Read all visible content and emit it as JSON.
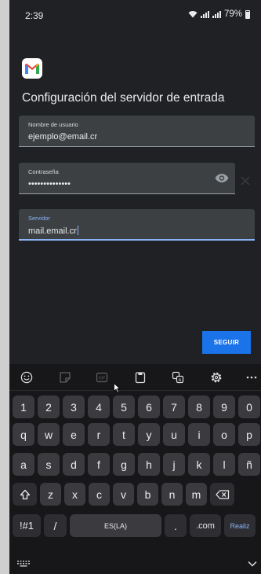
{
  "status_bar": {
    "time": "2:39",
    "battery": "79%"
  },
  "app": {
    "title": "Configuración del servidor de entrada"
  },
  "form": {
    "username": {
      "label": "Nombre de usuario",
      "value": "ejemplo@email.cr"
    },
    "password": {
      "label": "Contraseña",
      "value": "••••••••••••••"
    },
    "server": {
      "label": "Servidor",
      "value": "mail.email.cr"
    },
    "next_button": "SEGUIR"
  },
  "keyboard": {
    "number_row": [
      "1",
      "2",
      "3",
      "4",
      "5",
      "6",
      "7",
      "8",
      "9",
      "0"
    ],
    "row1": [
      "q",
      "w",
      "e",
      "r",
      "t",
      "y",
      "u",
      "i",
      "o",
      "p"
    ],
    "row2": [
      "a",
      "s",
      "d",
      "f",
      "g",
      "h",
      "j",
      "k",
      "l",
      "ñ"
    ],
    "row3": [
      "z",
      "x",
      "c",
      "v",
      "b",
      "n",
      "m"
    ],
    "symbols": "!#1",
    "slash": "/",
    "space": "ES(LA)",
    "dot": ".",
    "dotcom": ".com",
    "action": "Realiz"
  },
  "colors": {
    "background": "#202124",
    "accent": "#8ab4f8",
    "button": "#1a73e8",
    "keyboard": "#17171a",
    "key": "#3b3b3f"
  }
}
